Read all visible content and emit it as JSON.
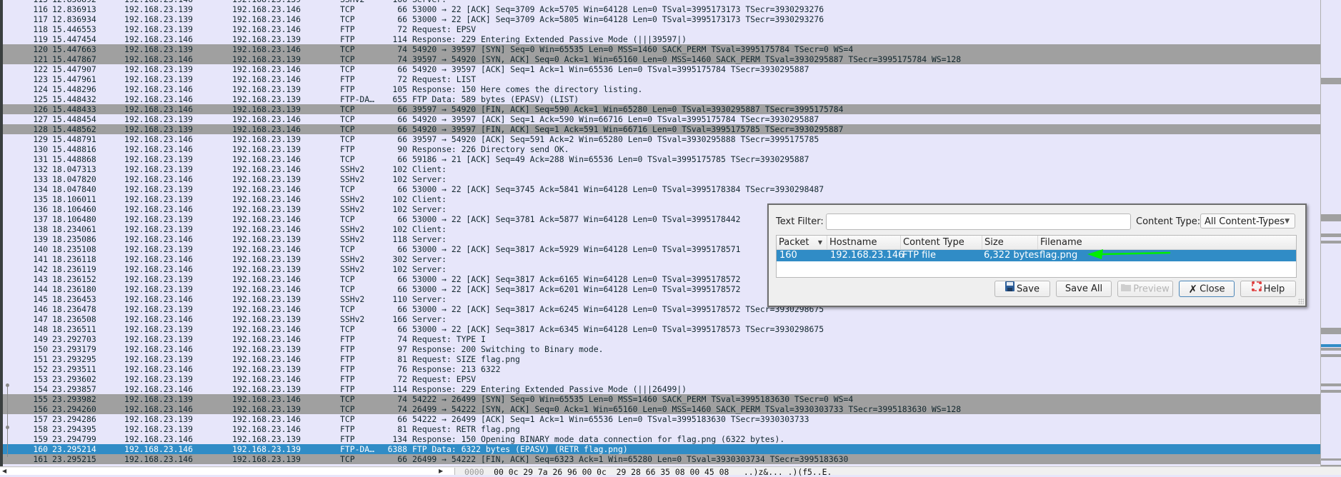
{
  "packet_list": {
    "rows": [
      {
        "no": "115",
        "time": "12.836892",
        "src": "192.168.23.146",
        "dst": "192.168.23.139",
        "proto": "SSHv2",
        "len": "166",
        "info": "Server:",
        "style": "normal"
      },
      {
        "no": "116",
        "time": "12.836913",
        "src": "192.168.23.139",
        "dst": "192.168.23.146",
        "proto": "TCP",
        "len": "66",
        "info": "53000 → 22 [ACK] Seq=3709 Ack=5705 Win=64128 Len=0 TSval=3995173173 TSecr=3930293276",
        "style": "normal"
      },
      {
        "no": "117",
        "time": "12.836934",
        "src": "192.168.23.139",
        "dst": "192.168.23.146",
        "proto": "TCP",
        "len": "66",
        "info": "53000 → 22 [ACK] Seq=3709 Ack=5805 Win=64128 Len=0 TSval=3995173173 TSecr=3930293276",
        "style": "normal"
      },
      {
        "no": "118",
        "time": "15.446553",
        "src": "192.168.23.139",
        "dst": "192.168.23.146",
        "proto": "FTP",
        "len": "72",
        "info": "Request: EPSV",
        "style": "normal"
      },
      {
        "no": "119",
        "time": "15.447454",
        "src": "192.168.23.146",
        "dst": "192.168.23.139",
        "proto": "FTP",
        "len": "114",
        "info": "Response: 229 Entering Extended Passive Mode (|||39597|)",
        "style": "normal"
      },
      {
        "no": "120",
        "time": "15.447663",
        "src": "192.168.23.139",
        "dst": "192.168.23.146",
        "proto": "TCP",
        "len": "74",
        "info": "54920 → 39597 [SYN] Seq=0 Win=65535 Len=0 MSS=1460 SACK_PERM TSval=3995175784 TSecr=0 WS=4",
        "style": "gray"
      },
      {
        "no": "121",
        "time": "15.447867",
        "src": "192.168.23.146",
        "dst": "192.168.23.139",
        "proto": "TCP",
        "len": "74",
        "info": "39597 → 54920 [SYN, ACK] Seq=0 Ack=1 Win=65160 Len=0 MSS=1460 SACK_PERM TSval=3930295887 TSecr=3995175784 WS=128",
        "style": "gray"
      },
      {
        "no": "122",
        "time": "15.447907",
        "src": "192.168.23.139",
        "dst": "192.168.23.146",
        "proto": "TCP",
        "len": "66",
        "info": "54920 → 39597 [ACK] Seq=1 Ack=1 Win=65536 Len=0 TSval=3995175784 TSecr=3930295887",
        "style": "normal"
      },
      {
        "no": "123",
        "time": "15.447961",
        "src": "192.168.23.139",
        "dst": "192.168.23.146",
        "proto": "FTP",
        "len": "72",
        "info": "Request: LIST",
        "style": "normal"
      },
      {
        "no": "124",
        "time": "15.448296",
        "src": "192.168.23.146",
        "dst": "192.168.23.139",
        "proto": "FTP",
        "len": "105",
        "info": "Response: 150 Here comes the directory listing.",
        "style": "normal"
      },
      {
        "no": "125",
        "time": "15.448432",
        "src": "192.168.23.146",
        "dst": "192.168.23.139",
        "proto": "FTP-DA…",
        "len": "655",
        "info": "FTP Data: 589 bytes (EPASV) (LIST)",
        "style": "normal"
      },
      {
        "no": "126",
        "time": "15.448433",
        "src": "192.168.23.146",
        "dst": "192.168.23.139",
        "proto": "TCP",
        "len": "66",
        "info": "39597 → 54920 [FIN, ACK] Seq=590 Ack=1 Win=65280 Len=0 TSval=3930295887 TSecr=3995175784",
        "style": "gray"
      },
      {
        "no": "127",
        "time": "15.448454",
        "src": "192.168.23.139",
        "dst": "192.168.23.146",
        "proto": "TCP",
        "len": "66",
        "info": "54920 → 39597 [ACK] Seq=1 Ack=590 Win=66716 Len=0 TSval=3995175784 TSecr=3930295887",
        "style": "normal"
      },
      {
        "no": "128",
        "time": "15.448562",
        "src": "192.168.23.139",
        "dst": "192.168.23.146",
        "proto": "TCP",
        "len": "66",
        "info": "54920 → 39597 [FIN, ACK] Seq=1 Ack=591 Win=66716 Len=0 TSval=3995175785 TSecr=3930295887",
        "style": "gray"
      },
      {
        "no": "129",
        "time": "15.448791",
        "src": "192.168.23.146",
        "dst": "192.168.23.139",
        "proto": "TCP",
        "len": "66",
        "info": "39597 → 54920 [ACK] Seq=591 Ack=2 Win=65280 Len=0 TSval=3930295888 TSecr=3995175785",
        "style": "normal"
      },
      {
        "no": "130",
        "time": "15.448816",
        "src": "192.168.23.146",
        "dst": "192.168.23.139",
        "proto": "FTP",
        "len": "90",
        "info": "Response: 226 Directory send OK.",
        "style": "normal"
      },
      {
        "no": "131",
        "time": "15.448868",
        "src": "192.168.23.139",
        "dst": "192.168.23.146",
        "proto": "TCP",
        "len": "66",
        "info": "59186 → 21 [ACK] Seq=49 Ack=288 Win=65536 Len=0 TSval=3995175785 TSecr=3930295887",
        "style": "normal"
      },
      {
        "no": "132",
        "time": "18.047313",
        "src": "192.168.23.139",
        "dst": "192.168.23.146",
        "proto": "SSHv2",
        "len": "102",
        "info": "Client:",
        "style": "normal"
      },
      {
        "no": "133",
        "time": "18.047820",
        "src": "192.168.23.146",
        "dst": "192.168.23.139",
        "proto": "SSHv2",
        "len": "102",
        "info": "Server:",
        "style": "normal"
      },
      {
        "no": "134",
        "time": "18.047840",
        "src": "192.168.23.139",
        "dst": "192.168.23.146",
        "proto": "TCP",
        "len": "66",
        "info": "53000 → 22 [ACK] Seq=3745 Ack=5841 Win=64128 Len=0 TSval=3995178384 TSecr=3930298487",
        "style": "normal"
      },
      {
        "no": "135",
        "time": "18.106011",
        "src": "192.168.23.139",
        "dst": "192.168.23.146",
        "proto": "SSHv2",
        "len": "102",
        "info": "Client:",
        "style": "normal"
      },
      {
        "no": "136",
        "time": "18.106460",
        "src": "192.168.23.146",
        "dst": "192.168.23.139",
        "proto": "SSHv2",
        "len": "102",
        "info": "Server:",
        "style": "normal"
      },
      {
        "no": "137",
        "time": "18.106480",
        "src": "192.168.23.139",
        "dst": "192.168.23.146",
        "proto": "TCP",
        "len": "66",
        "info": "53000 → 22 [ACK] Seq=3781 Ack=5877 Win=64128 Len=0 TSval=3995178442",
        "style": "normal"
      },
      {
        "no": "138",
        "time": "18.234061",
        "src": "192.168.23.139",
        "dst": "192.168.23.146",
        "proto": "SSHv2",
        "len": "102",
        "info": "Client:",
        "style": "normal"
      },
      {
        "no": "139",
        "time": "18.235086",
        "src": "192.168.23.146",
        "dst": "192.168.23.139",
        "proto": "SSHv2",
        "len": "118",
        "info": "Server:",
        "style": "normal"
      },
      {
        "no": "140",
        "time": "18.235108",
        "src": "192.168.23.139",
        "dst": "192.168.23.146",
        "proto": "TCP",
        "len": "66",
        "info": "53000 → 22 [ACK] Seq=3817 Ack=5929 Win=64128 Len=0 TSval=3995178571",
        "style": "normal"
      },
      {
        "no": "141",
        "time": "18.236118",
        "src": "192.168.23.146",
        "dst": "192.168.23.139",
        "proto": "SSHv2",
        "len": "302",
        "info": "Server:",
        "style": "normal"
      },
      {
        "no": "142",
        "time": "18.236119",
        "src": "192.168.23.146",
        "dst": "192.168.23.139",
        "proto": "SSHv2",
        "len": "102",
        "info": "Server:",
        "style": "normal"
      },
      {
        "no": "143",
        "time": "18.236152",
        "src": "192.168.23.139",
        "dst": "192.168.23.146",
        "proto": "TCP",
        "len": "66",
        "info": "53000 → 22 [ACK] Seq=3817 Ack=6165 Win=64128 Len=0 TSval=3995178572",
        "style": "normal"
      },
      {
        "no": "144",
        "time": "18.236180",
        "src": "192.168.23.139",
        "dst": "192.168.23.146",
        "proto": "TCP",
        "len": "66",
        "info": "53000 → 22 [ACK] Seq=3817 Ack=6201 Win=64128 Len=0 TSval=3995178572",
        "style": "normal"
      },
      {
        "no": "145",
        "time": "18.236453",
        "src": "192.168.23.146",
        "dst": "192.168.23.139",
        "proto": "SSHv2",
        "len": "110",
        "info": "Server:",
        "style": "normal"
      },
      {
        "no": "146",
        "time": "18.236478",
        "src": "192.168.23.139",
        "dst": "192.168.23.146",
        "proto": "TCP",
        "len": "66",
        "info": "53000 → 22 [ACK] Seq=3817 Ack=6245 Win=64128 Len=0 TSval=3995178572 TSecr=3930298675",
        "style": "normal"
      },
      {
        "no": "147",
        "time": "18.236508",
        "src": "192.168.23.146",
        "dst": "192.168.23.139",
        "proto": "SSHv2",
        "len": "166",
        "info": "Server:",
        "style": "normal"
      },
      {
        "no": "148",
        "time": "18.236511",
        "src": "192.168.23.139",
        "dst": "192.168.23.146",
        "proto": "TCP",
        "len": "66",
        "info": "53000 → 22 [ACK] Seq=3817 Ack=6345 Win=64128 Len=0 TSval=3995178573 TSecr=3930298675",
        "style": "normal"
      },
      {
        "no": "149",
        "time": "23.292703",
        "src": "192.168.23.139",
        "dst": "192.168.23.146",
        "proto": "FTP",
        "len": "74",
        "info": "Request: TYPE I",
        "style": "normal"
      },
      {
        "no": "150",
        "time": "23.293179",
        "src": "192.168.23.146",
        "dst": "192.168.23.139",
        "proto": "FTP",
        "len": "97",
        "info": "Response: 200 Switching to Binary mode.",
        "style": "normal"
      },
      {
        "no": "151",
        "time": "23.293295",
        "src": "192.168.23.139",
        "dst": "192.168.23.146",
        "proto": "FTP",
        "len": "81",
        "info": "Request: SIZE flag.png",
        "style": "normal"
      },
      {
        "no": "152",
        "time": "23.293511",
        "src": "192.168.23.146",
        "dst": "192.168.23.139",
        "proto": "FTP",
        "len": "76",
        "info": "Response: 213 6322",
        "style": "normal"
      },
      {
        "no": "153",
        "time": "23.293602",
        "src": "192.168.23.139",
        "dst": "192.168.23.146",
        "proto": "FTP",
        "len": "72",
        "info": "Request: EPSV",
        "style": "normal"
      },
      {
        "no": "154",
        "time": "23.293857",
        "src": "192.168.23.146",
        "dst": "192.168.23.139",
        "proto": "FTP",
        "len": "114",
        "info": "Response: 229 Entering Extended Passive Mode (|||26499|)",
        "style": "normal"
      },
      {
        "no": "155",
        "time": "23.293982",
        "src": "192.168.23.139",
        "dst": "192.168.23.146",
        "proto": "TCP",
        "len": "74",
        "info": "54222 → 26499 [SYN] Seq=0 Win=65535 Len=0 MSS=1460 SACK_PERM TSval=3995183630 TSecr=0 WS=4",
        "style": "gray"
      },
      {
        "no": "156",
        "time": "23.294260",
        "src": "192.168.23.146",
        "dst": "192.168.23.139",
        "proto": "TCP",
        "len": "74",
        "info": "26499 → 54222 [SYN, ACK] Seq=0 Ack=1 Win=65160 Len=0 MSS=1460 SACK_PERM TSval=3930303733 TSecr=3995183630 WS=128",
        "style": "gray"
      },
      {
        "no": "157",
        "time": "23.294286",
        "src": "192.168.23.139",
        "dst": "192.168.23.146",
        "proto": "TCP",
        "len": "66",
        "info": "54222 → 26499 [ACK] Seq=1 Ack=1 Win=65536 Len=0 TSval=3995183630 TSecr=3930303733",
        "style": "normal"
      },
      {
        "no": "158",
        "time": "23.294395",
        "src": "192.168.23.139",
        "dst": "192.168.23.146",
        "proto": "FTP",
        "len": "81",
        "info": "Request: RETR flag.png",
        "style": "normal"
      },
      {
        "no": "159",
        "time": "23.294799",
        "src": "192.168.23.146",
        "dst": "192.168.23.139",
        "proto": "FTP",
        "len": "134",
        "info": "Response: 150 Opening BINARY mode data connection for flag.png (6322 bytes).",
        "style": "normal"
      },
      {
        "no": "160",
        "time": "23.295214",
        "src": "192.168.23.146",
        "dst": "192.168.23.139",
        "proto": "FTP-DA…",
        "len": "6388",
        "info": "FTP Data: 6322 bytes (EPASV) (RETR flag.png)",
        "style": "selected"
      },
      {
        "no": "161",
        "time": "23.295215",
        "src": "192.168.23.146",
        "dst": "192.168.23.139",
        "proto": "TCP",
        "len": "66",
        "info": "26499 → 54222 [FIN, ACK] Seq=6323 Ack=1 Win=65280 Len=0 TSval=3930303734 TSecr=3995183630",
        "style": "gray"
      }
    ]
  },
  "bytes_pane": {
    "offset": "0000",
    "hex": "00 0c 29 7a 26 96 00 0c  29 28 66 35 08 00 45 08",
    "ascii": "..)z&... .)(f5..E."
  },
  "export_dialog": {
    "text_filter_label": "Text Filter:",
    "text_filter_value": "",
    "content_type_label": "Content Type:",
    "content_type_value": "All Content-Types",
    "columns": [
      "Packet",
      "Hostname",
      "Content Type",
      "Size",
      "Filename"
    ],
    "rows": [
      {
        "packet": "160",
        "hostname": "192.168.23.146",
        "content_type": "FTP file",
        "size": "6,322 bytes",
        "filename": "flag.png"
      }
    ],
    "buttons": {
      "save": "Save",
      "save_all": "Save All",
      "preview": "Preview",
      "close": "Close",
      "help": "Help"
    }
  },
  "colors": {
    "row_bg": "#e7e6fa",
    "marked_gray": "#a0a0a0",
    "selected": "#308cc6",
    "annotation_arrow": "#00ee00"
  },
  "icons": {
    "save": "floppy-disk-icon",
    "preview": "folder-icon",
    "close": "x-icon",
    "help": "lifebuoy-icon",
    "sort": "sort-descending-icon"
  }
}
